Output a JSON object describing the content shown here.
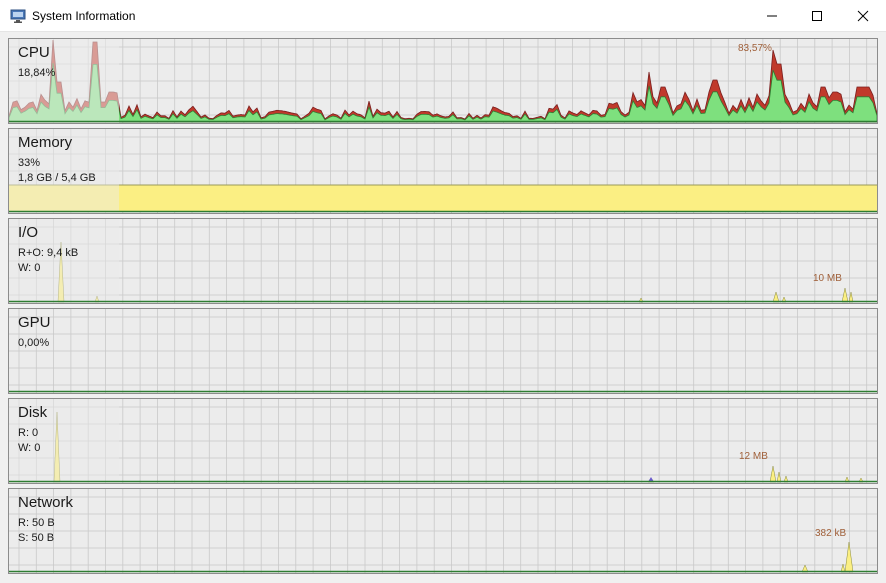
{
  "window": {
    "title": "System Information"
  },
  "panels": {
    "cpu": {
      "title": "CPU",
      "value": "18,84%",
      "peak": "83,57%"
    },
    "memory": {
      "title": "Memory",
      "percent": "33%",
      "usage": "1,8 GB / 5,4 GB"
    },
    "io": {
      "title": "I/O",
      "read_other": "R+O: 9,4 kB",
      "write": "W: 0",
      "peak": "10 MB"
    },
    "gpu": {
      "title": "GPU",
      "value": "0,00%"
    },
    "disk": {
      "title": "Disk",
      "read": "R: 0",
      "write": "W: 0",
      "peak": "12 MB"
    },
    "network": {
      "title": "Network",
      "receive": "R: 50 B",
      "send": "S: 50 B",
      "peak": "382 kB"
    }
  },
  "colors": {
    "cpu_fill": "#7ee07e",
    "cpu_kernel": "#c0392b",
    "memory_fill": "#fbef83",
    "graph_line": "#2e7d32",
    "grid": "#c9c9c9"
  }
}
